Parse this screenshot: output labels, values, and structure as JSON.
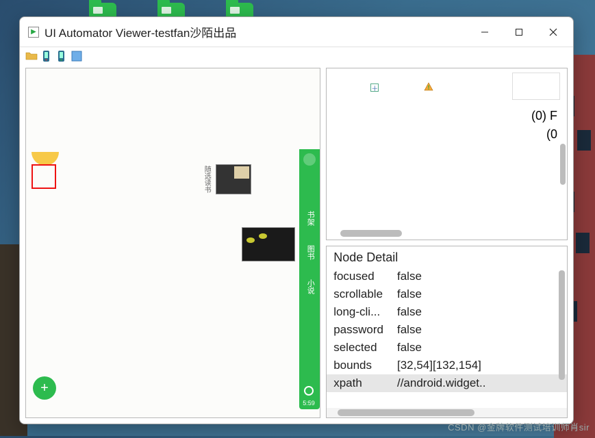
{
  "window": {
    "title": "UI Automator Viewer-testfan沙陌出品"
  },
  "toolbar": {
    "open": "open-file",
    "dump1": "device-dump-1",
    "dump2": "device-dump-2",
    "save": "save-screenshot"
  },
  "tree": {
    "line1": "(0) F",
    "line2": "(0"
  },
  "device": {
    "categories": [
      "书架",
      "图书",
      "小说"
    ],
    "book_labels": "随选读书"
  },
  "detail": {
    "title": "Node Detail",
    "rows": [
      {
        "key": "focused",
        "value": "false"
      },
      {
        "key": "scrollable",
        "value": "false"
      },
      {
        "key": "long-cli...",
        "value": "false"
      },
      {
        "key": "password",
        "value": "false"
      },
      {
        "key": "selected",
        "value": "false"
      },
      {
        "key": "bounds",
        "value": "[32,54][132,154]"
      },
      {
        "key": "xpath",
        "value": "//android.widget..",
        "selected": true
      }
    ]
  },
  "watermark": "CSDN @金牌软件测试培训师肖sir"
}
